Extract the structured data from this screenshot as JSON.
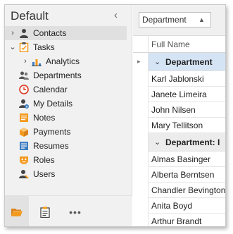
{
  "nav": {
    "title": "Default",
    "collapse_glyph": "‹",
    "items": [
      {
        "label": "Contacts",
        "expander": "›",
        "icon": "contact-person-icon"
      },
      {
        "label": "Tasks",
        "expander": "⌄",
        "icon": "tasks-clipboard-icon"
      },
      {
        "label": "Analytics",
        "expander": "›",
        "icon": "analytics-chart-icon"
      },
      {
        "label": "Departments",
        "icon": "departments-people-icon"
      },
      {
        "label": "Calendar",
        "icon": "calendar-clock-icon"
      },
      {
        "label": "My Details",
        "icon": "my-details-user-icon"
      },
      {
        "label": "Notes",
        "icon": "notes-icon"
      },
      {
        "label": "Payments",
        "icon": "payments-box-icon"
      },
      {
        "label": "Resumes",
        "icon": "resumes-icon"
      },
      {
        "label": "Roles",
        "icon": "roles-mask-icon"
      },
      {
        "label": "Users",
        "icon": "users-icon"
      }
    ],
    "bottom": {
      "folder_icon": "folder-icon",
      "clipboard_icon": "clipboard-icon",
      "more_label": "•••"
    }
  },
  "grid": {
    "group_panel": {
      "chip_label": "Department",
      "sort_glyph": "▲"
    },
    "column_header": "Full Name",
    "group1": {
      "label": "Department",
      "chevron": "⌄",
      "pointer": "▸"
    },
    "group1_rows": [
      "Karl Jablonski",
      "Janete Limeira",
      "John Nilsen",
      "Mary Tellitson"
    ],
    "group2": {
      "label": "Department: I",
      "chevron": "⌄"
    },
    "group2_rows": [
      "Almas Basinger",
      "Alberta Berntsen",
      "Chandler Bevington",
      "Anita Boyd",
      "Arthur Brandt"
    ]
  },
  "colors": {
    "nav_bg": "#f1f1f1",
    "selection": "#e0e0e0",
    "focused_group": "#d5e4f5",
    "accent_orange": "#f39a1e",
    "accent_blue": "#3f7fc1"
  }
}
